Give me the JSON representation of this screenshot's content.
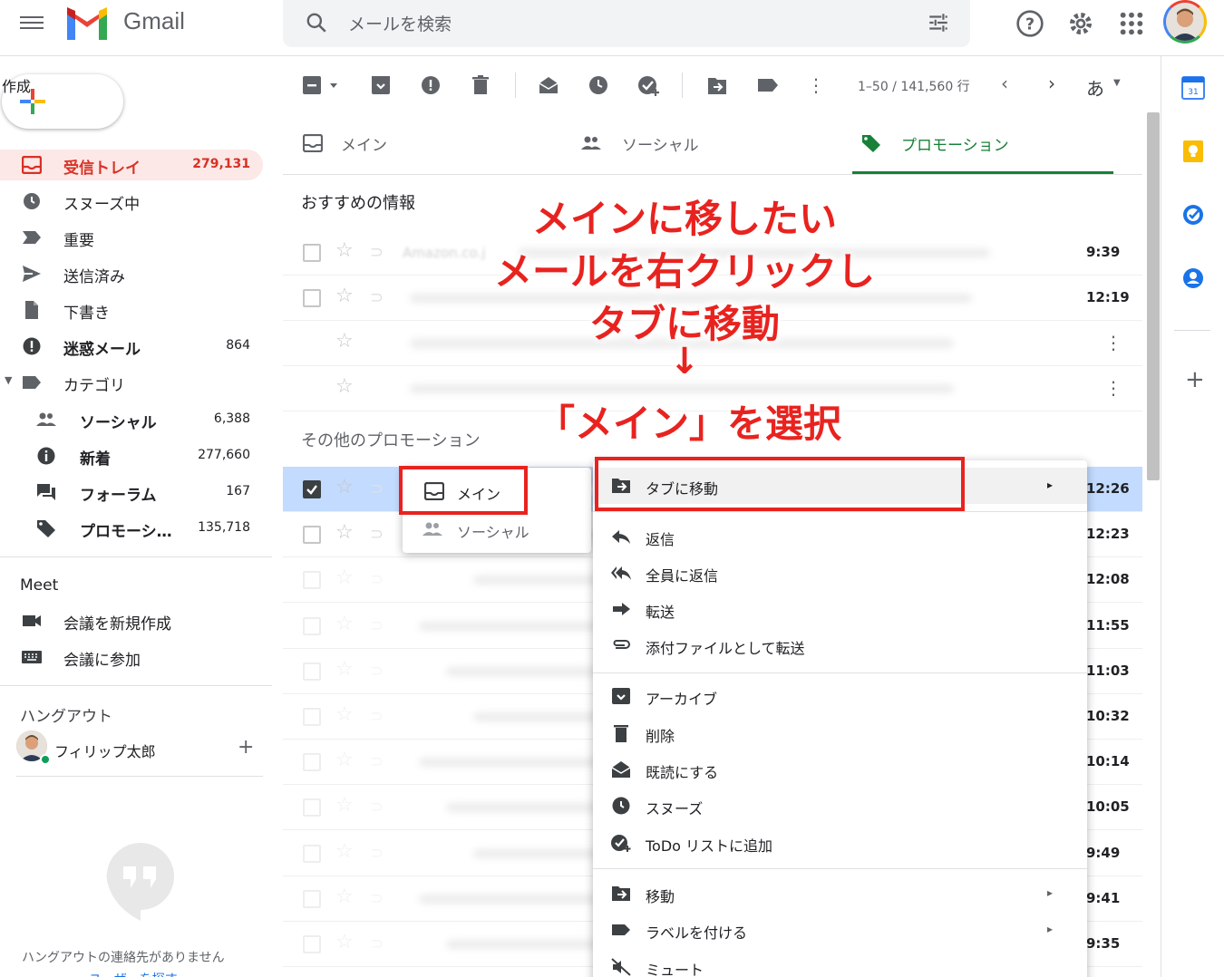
{
  "header": {
    "app_name": "Gmail",
    "search_placeholder": "メールを検索"
  },
  "sidebar": {
    "compose_label": "作成",
    "items": [
      {
        "label": "受信トレイ",
        "count": "279,131"
      },
      {
        "label": "スヌーズ中",
        "count": ""
      },
      {
        "label": "重要",
        "count": ""
      },
      {
        "label": "送信済み",
        "count": ""
      },
      {
        "label": "下書き",
        "count": ""
      },
      {
        "label": "迷惑メール",
        "count": "864"
      },
      {
        "label": "カテゴリ",
        "count": ""
      }
    ],
    "categories": [
      {
        "label": "ソーシャル",
        "count": "6,388"
      },
      {
        "label": "新着",
        "count": "277,660"
      },
      {
        "label": "フォーラム",
        "count": "167"
      },
      {
        "label": "プロモーシ…",
        "count": "135,718"
      }
    ],
    "meet": {
      "title": "Meet",
      "new_meeting": "会議を新規作成",
      "join_meeting": "会議に参加"
    },
    "hangouts": {
      "title": "ハングアウト",
      "user": "フィリップ太郎",
      "empty_text": "ハングアウトの連絡先がありません",
      "find_link": "ユーザーを探す"
    }
  },
  "toolbar": {
    "page_info": "1–50 / 141,560 行",
    "input_tool": "あ"
  },
  "tabs": [
    {
      "label": "メイン"
    },
    {
      "label": "ソーシャル"
    },
    {
      "label": "プロモーション"
    }
  ],
  "sections": {
    "recommended": "おすすめの情報",
    "other": "その他のプロモーション"
  },
  "rows": {
    "top": [
      {
        "sender": "Amazon.co.j",
        "time": "9:39"
      },
      {
        "sender": "",
        "time": "12:19"
      },
      {
        "sender": "",
        "time": ""
      },
      {
        "sender": "",
        "time": ""
      }
    ],
    "bottom_times": [
      "12:26",
      "12:23",
      "12:08",
      "11:55",
      "11:03",
      "10:32",
      "10:14",
      "10:05",
      "9:49",
      "9:41",
      "9:35"
    ]
  },
  "annotation": {
    "line1": "メインに移したい",
    "line2": "メールを右クリックし",
    "line3": "タブに移動",
    "arrow": "↓",
    "line4": "「メイン」を選択"
  },
  "context_menu": {
    "move_to_tab": "タブに移動",
    "reply": "返信",
    "reply_all": "全員に返信",
    "forward": "転送",
    "forward_attach": "添付ファイルとして転送",
    "archive": "アーカイブ",
    "delete": "削除",
    "mark_read": "既読にする",
    "snooze": "スヌーズ",
    "add_todo": "ToDo リストに追加",
    "move": "移動",
    "label": "ラベルを付ける",
    "mute": "ミュート"
  },
  "submenu": {
    "main": "メイン",
    "social": "ソーシャル"
  },
  "colors": {
    "accent_red": "#d93025",
    "annotation_red": "#e8231f",
    "selected_row": "#c2dbff",
    "promo_green": "#188038"
  }
}
